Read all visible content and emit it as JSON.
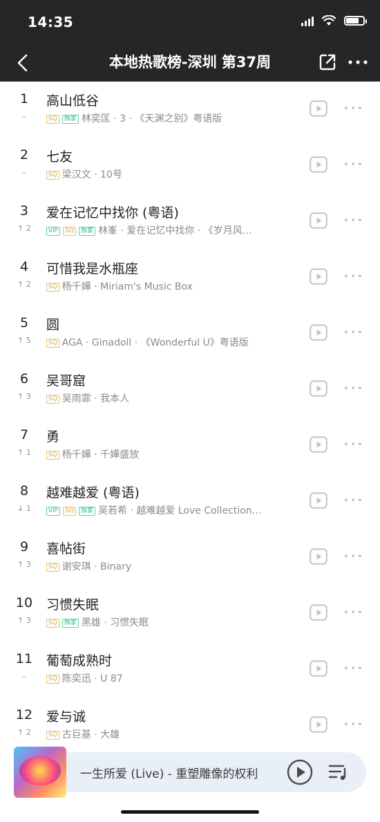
{
  "status_bar": {
    "time": "14:35"
  },
  "nav": {
    "title": "本地热歌榜-深圳 第37周"
  },
  "icons": {
    "back": "chevron-left-icon",
    "share": "share-icon",
    "more": "more-dots-icon",
    "play": "play-icon",
    "queue": "playlist-icon"
  },
  "colors": {
    "header_bg": "#252628",
    "sq": "#d8a33a",
    "vip": "#2ebf8c",
    "mini_player_bg": "#e9eff7"
  },
  "songs": [
    {
      "rank": "1",
      "trend": "–",
      "title": "高山低谷",
      "badges": [
        "SQ",
        "独家"
      ],
      "meta": "林奕匡 · 3 · 《天渊之别》粤语版"
    },
    {
      "rank": "2",
      "trend": "–",
      "title": "七友",
      "badges": [
        "SQ"
      ],
      "meta": "梁汉文 · 10号"
    },
    {
      "rank": "3",
      "trend": "↑ 2",
      "title": "爱在记忆中找你 (粤语)",
      "badges": [
        "VIP",
        "SQ",
        "独家"
      ],
      "meta": "林峯 · 爱在记忆中找你 · 《岁月风…"
    },
    {
      "rank": "4",
      "trend": "↑ 2",
      "title": "可惜我是水瓶座",
      "badges": [
        "SQ"
      ],
      "meta": "杨千嬅 · Miriam's Music Box"
    },
    {
      "rank": "5",
      "trend": "↑ 5",
      "title": "圆",
      "badges": [
        "SQ"
      ],
      "meta": "AGA · Ginadoll · 《Wonderful U》粤语版"
    },
    {
      "rank": "6",
      "trend": "↑ 3",
      "title": "吴哥窟",
      "badges": [
        "SQ"
      ],
      "meta": "吴雨霏 · 我本人"
    },
    {
      "rank": "7",
      "trend": "↑ 1",
      "title": "勇",
      "badges": [
        "SQ"
      ],
      "meta": "杨千嬅 · 千嬅盛放"
    },
    {
      "rank": "8",
      "trend": "↓ 1",
      "title": "越难越爱 (粤语)",
      "badges": [
        "VIP",
        "SQ",
        "独家"
      ],
      "meta": "吴若希 · 越难越爱 Love Collection…"
    },
    {
      "rank": "9",
      "trend": "↑ 3",
      "title": "喜帖街",
      "badges": [
        "SQ"
      ],
      "meta": "谢安琪 · Binary"
    },
    {
      "rank": "10",
      "trend": "↑ 3",
      "title": "习惯失眠",
      "badges": [
        "SQ",
        "独家"
      ],
      "meta": "黑雄 · 习惯失眠"
    },
    {
      "rank": "11",
      "trend": "–",
      "title": "葡萄成熟时",
      "badges": [
        "SQ"
      ],
      "meta": "陈奕迅 · U 87"
    },
    {
      "rank": "12",
      "trend": "↑ 2",
      "title": "爱与诚",
      "badges": [
        "SQ"
      ],
      "meta": "古巨基 · 大雄"
    }
  ],
  "now_playing": {
    "text": "一生所爱 (Live) - 重塑雕像的权利"
  }
}
